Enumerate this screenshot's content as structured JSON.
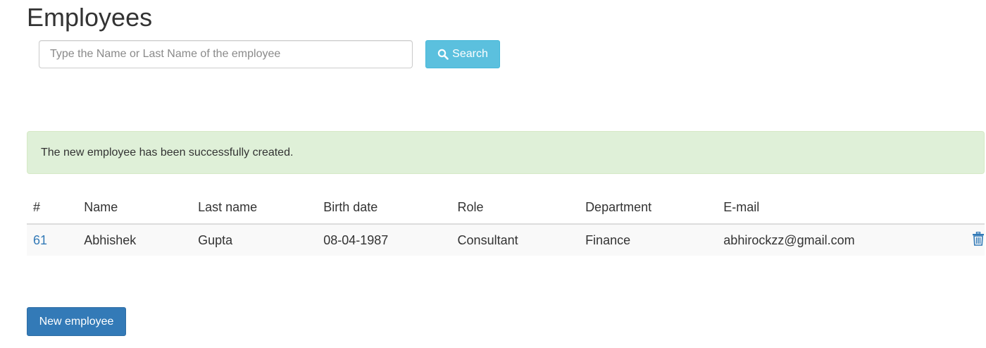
{
  "page": {
    "title": "Employees"
  },
  "search": {
    "placeholder": "Type the Name or Last Name of the employee",
    "value": "",
    "button_label": "Search",
    "button_icon": "search-icon"
  },
  "alert": {
    "message": "The new employee has been successfully created.",
    "type": "success"
  },
  "table": {
    "columns": [
      "#",
      "Name",
      "Last name",
      "Birth date",
      "Role",
      "Department",
      "E-mail"
    ],
    "rows": [
      {
        "id": "61",
        "name": "Abhishek",
        "last_name": "Gupta",
        "birth_date": "08-04-1987",
        "role": "Consultant",
        "department": "Finance",
        "email": "abhirockzz@gmail.com",
        "action_icon": "trash-icon"
      }
    ]
  },
  "actions": {
    "new_employee_label": "New employee"
  },
  "colors": {
    "info_button": "#5bc0de",
    "primary_button": "#337ab7",
    "success_alert": "#dff0d8",
    "link": "#337ab7"
  }
}
